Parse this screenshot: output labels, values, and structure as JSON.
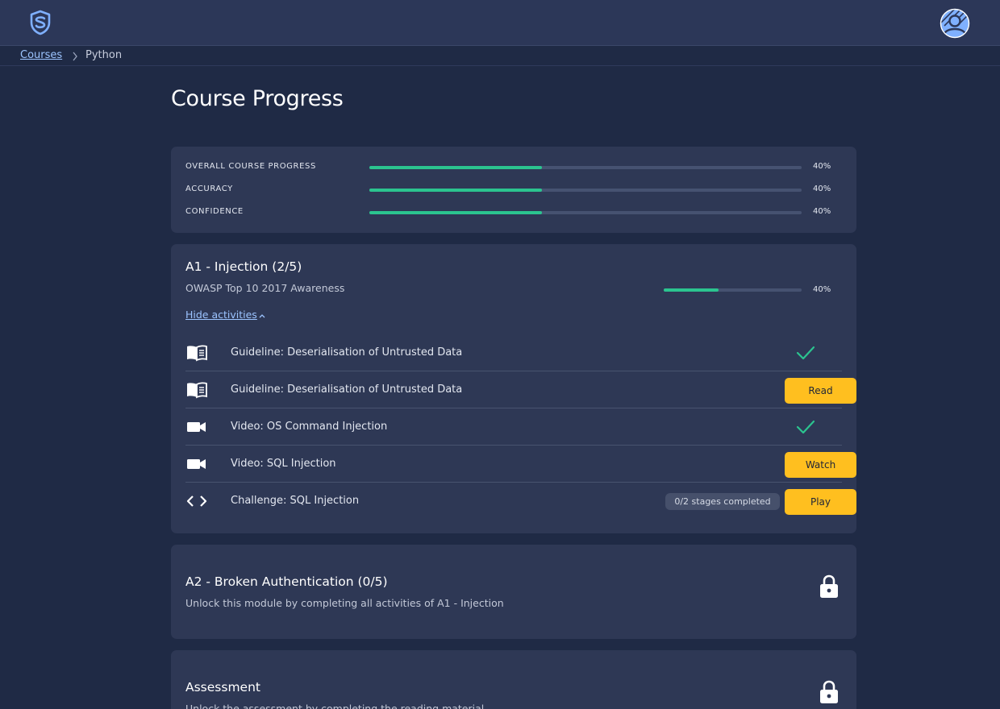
{
  "header": {
    "logo_icon": "shield-logo-icon",
    "avatar_icon": "user-avatar-icon"
  },
  "breadcrumb": {
    "link": "Courses",
    "separator": ">",
    "current": "Python"
  },
  "page_title": "Course Progress",
  "colors": {
    "accent_green": "#2bc48f",
    "button_yellow": "#ffbf1f",
    "link_blue": "#9cc4ff",
    "card_bg": "#2e3855"
  },
  "overall": {
    "metrics": [
      {
        "label": "OVERALL COURSE PROGRESS",
        "value_text": "40%",
        "progress": 0.4
      },
      {
        "label": "ACCURACY",
        "value_text": "40%",
        "progress": 0.4
      },
      {
        "label": "CONFIDENCE",
        "value_text": "40%",
        "progress": 0.4
      }
    ]
  },
  "module_a1": {
    "title": "A1 - Injection (2/5)",
    "subtitle": "OWASP Top 10 2017 Awareness",
    "progress_text": "40%",
    "progress": 0.4,
    "toggle_label": "Hide activities",
    "toggle_chevron": "^",
    "activities": [
      {
        "icon": "book-icon",
        "label": "Guideline: Deserialisation of Untrusted Data",
        "status": "completed"
      },
      {
        "icon": "book-icon",
        "label": "Guideline: Deserialisation of Untrusted Data",
        "button": "Read"
      },
      {
        "icon": "video-icon",
        "label": "Video: OS Command Injection",
        "status": "completed"
      },
      {
        "icon": "video-icon",
        "label": "Video: SQL Injection",
        "button": "Watch"
      },
      {
        "icon": "code-icon",
        "label": "Challenge: SQL Injection",
        "chip": "0/2 stages completed",
        "button": "Play"
      }
    ]
  },
  "module_a2": {
    "title": "A2 - Broken Authentication (0/5)",
    "subtitle": "Unlock this module by completing all activities of A1 - Injection",
    "icon": "lock-icon"
  },
  "assessment": {
    "title": "Assessment",
    "subtitle": "Unlock the assessment by completing the reading material",
    "icon": "lock-icon"
  }
}
